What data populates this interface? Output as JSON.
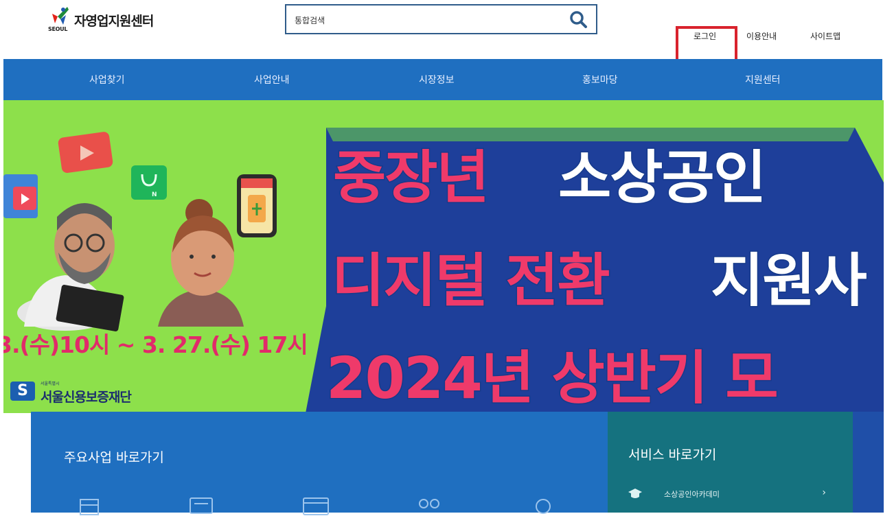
{
  "header": {
    "logo_title": "자영업지원센터",
    "logo_sub": "SEOUL",
    "search_placeholder": "통합검색",
    "util_links": {
      "login": "로그인",
      "guide": "이용안내",
      "sitemap": "사이트맵"
    }
  },
  "nav": {
    "items": [
      {
        "label": "사업찾기"
      },
      {
        "label": "사업안내"
      },
      {
        "label": "시장정보"
      },
      {
        "label": "홍보마당"
      },
      {
        "label": "지원센터"
      }
    ]
  },
  "banner": {
    "line1_a": "중장년",
    "line1_b": "소상공인",
    "line2_a": "디지털 전환",
    "line2_b": "지원사",
    "line3": "2024년 상반기 모",
    "date_text": "3.(수)10시 ~ 3. 27.(수) 17시",
    "sponsor_small": "서울특별시",
    "sponsor_name": "서울신용보증재단",
    "sponsor_badge": "S"
  },
  "quick_links": {
    "title": "주요사업 바로가기",
    "icons": [
      "store-icon",
      "computer-icon",
      "browser-icon",
      "people-icon",
      "coins-icon"
    ]
  },
  "services": {
    "title": "서비스 바로가기",
    "items": [
      {
        "label": "소상공인아카데미",
        "icon": "graduation-cap-icon"
      }
    ]
  },
  "colors": {
    "nav_bg": "#1f6fc0",
    "banner_bg": "#8de04b",
    "banner_pink": "#ef3a6a",
    "banner_navy": "#163a8a",
    "service_bg": "#15727f",
    "highlight": "#d9232d"
  }
}
